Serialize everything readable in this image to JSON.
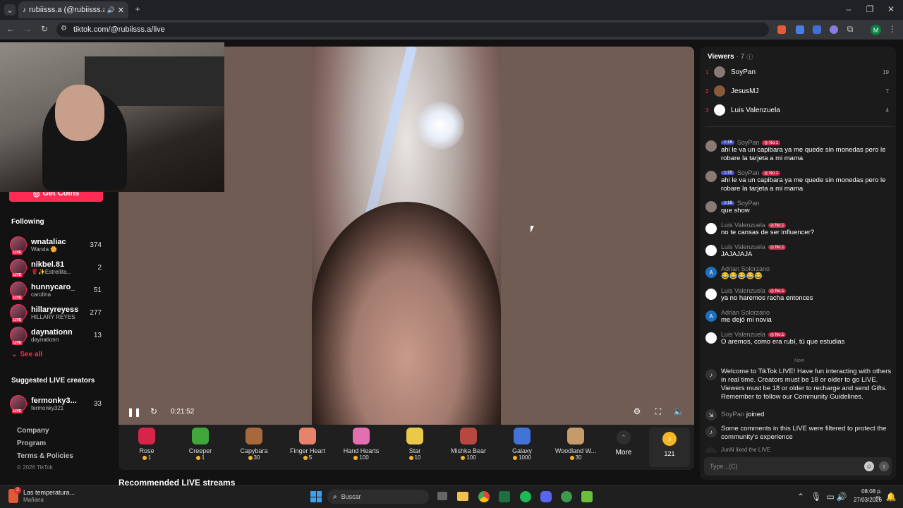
{
  "browser": {
    "tab_title": "rubiisss.a (@rubiisss.a) is LIVE",
    "url": "tiktok.com/@rubiisss.a/live",
    "profile_initial": "M"
  },
  "sidebar": {
    "get_coins": "Get Coins",
    "following_title": "Following",
    "following": [
      {
        "name": "wnataliac",
        "sub": "Wanda 🌼",
        "count": "374"
      },
      {
        "name": "nikbel.81",
        "sub": "🌹✨Estrellita...",
        "count": "2"
      },
      {
        "name": "hunnycaro_",
        "sub": "carolina",
        "count": "51"
      },
      {
        "name": "hillaryreyess",
        "sub": "HILLARY REYES",
        "count": "277"
      },
      {
        "name": "daynationn",
        "sub": "daynationn",
        "count": "13"
      }
    ],
    "see_all": "See all",
    "suggested_title": "Suggested LIVE creators",
    "suggested": [
      {
        "name": "fermonky3...",
        "sub": "fermonky321",
        "count": "33"
      }
    ],
    "footer": [
      "Company",
      "Program",
      "Terms & Policies"
    ],
    "copyright": "© 2026 TikTok",
    "live_badge": "LIVE"
  },
  "player": {
    "time": "0:21:52",
    "recommended": "Recommended LIVE streams"
  },
  "gifts": [
    {
      "name": "Rose",
      "price": "1",
      "color": "#d9244a"
    },
    {
      "name": "Creeper",
      "price": "1",
      "color": "#3fa63a"
    },
    {
      "name": "Capybara",
      "price": "30",
      "color": "#a8683c"
    },
    {
      "name": "Finger Heart",
      "price": "5",
      "color": "#e7836b"
    },
    {
      "name": "Hand Hearts",
      "price": "100",
      "color": "#e46fb0"
    },
    {
      "name": "Star",
      "price": "10",
      "color": "#e9c84a"
    },
    {
      "name": "Mishka Bear",
      "price": "100",
      "color": "#b5493f"
    },
    {
      "name": "Galaxy",
      "price": "1000",
      "color": "#4273d6"
    },
    {
      "name": "Woodland W...",
      "price": "30",
      "color": "#c79a6a"
    }
  ],
  "more_label": "More",
  "coins_label": "121",
  "viewers": {
    "title": "Viewers",
    "count": "· 7",
    "list": [
      {
        "rank": "1",
        "name": "SoyPan",
        "score": "19"
      },
      {
        "rank": "2",
        "name": "JesusMJ",
        "score": "7"
      },
      {
        "rank": "3",
        "name": "Luis Valenzuela",
        "score": "4"
      }
    ]
  },
  "chat": [
    {
      "user": "SoyPan",
      "level": "16",
      "badge": "No.1",
      "text": "ahi le va un capibara ya me quede sin monedas pero le robare la tarjeta a mi mama"
    },
    {
      "user": "SoyPan",
      "level": "16",
      "badge": "No.1",
      "text": "ahi le va un capibara ya me quede sin monedas pero le robare la tarjeta a mi mama"
    },
    {
      "user": "SoyPan",
      "level": "16",
      "badge": "",
      "text": "que show"
    },
    {
      "user": "Luis Valenzuela",
      "level": "",
      "badge": "No.1",
      "text": "no te cansas de ser influencer?"
    },
    {
      "user": "Luis Valenzuela",
      "level": "",
      "badge": "No.1",
      "text": "JAJAJAJA"
    },
    {
      "user": "Adrian Solorzano",
      "level": "",
      "badge": "",
      "text": "😂😂😂😂😂"
    },
    {
      "user": "Luis Valenzuela",
      "level": "",
      "badge": "No.1",
      "text": "ya no haremos racha entonces"
    },
    {
      "user": "Adrian Solorzano",
      "level": "",
      "badge": "",
      "text": "me dejó mi novia"
    },
    {
      "user": "Luis Valenzuela",
      "level": "",
      "badge": "No.1",
      "text": "O aremos, como era rubí, tú que estudias"
    }
  ],
  "now_label": "Now",
  "system_msgs": {
    "welcome": "Welcome to TikTok LIVE! Have fun interacting with others in real time. Creators must be 18 or older to go LIVE. Viewers must be 18 or older to recharge and send Gifts. Remember to follow our Community Guidelines.",
    "joined_user": "SoyPan",
    "joined": "joined",
    "filtered": "Some comments in this LIVE were filtered to protect the community's experience",
    "liked": "JunN liked the LIVE"
  },
  "chat_input_placeholder": "Type...(C)",
  "taskbar": {
    "weather": "Las temperatura...",
    "weather_sub": "Mañana",
    "weather_badge": "2",
    "search": "Buscar",
    "time": "08:08 p. m.",
    "date": "27/03/2026"
  }
}
